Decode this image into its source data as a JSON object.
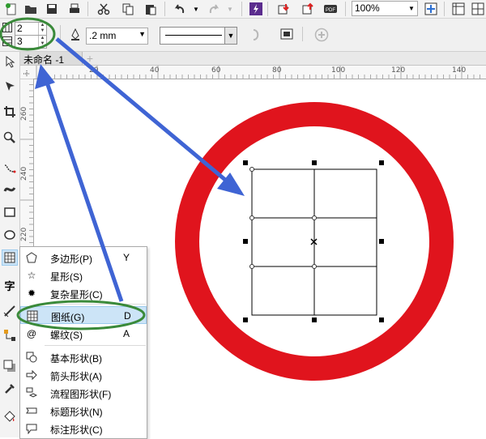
{
  "toolbar": {
    "zoom_value": "100%"
  },
  "property_bar": {
    "grid_columns": "2",
    "grid_rows": "3",
    "outline_width": ".2 mm"
  },
  "document": {
    "tab_name": "未命名 -1",
    "add_tab_symbol": "+"
  },
  "rulers": {
    "horizontal_labels": [
      "20",
      "40",
      "60",
      "80",
      "100",
      "120",
      "140"
    ],
    "vertical_labels": [
      "260",
      "240",
      "220"
    ]
  },
  "flyout": {
    "items": [
      {
        "label": "多边形(P)",
        "shortcut": "Y",
        "icon": "polygon-icon"
      },
      {
        "label": "星形(S)",
        "shortcut": "",
        "icon": "star-icon"
      },
      {
        "label": "复杂星形(C)",
        "shortcut": "",
        "icon": "complex-star-icon"
      },
      {
        "label": "图纸(G)",
        "shortcut": "D",
        "icon": "graph-paper-icon",
        "selected": true
      },
      {
        "label": "螺纹(S)",
        "shortcut": "A",
        "icon": "spiral-icon"
      },
      {
        "label": "基本形状(B)",
        "shortcut": "",
        "icon": "basic-shapes-icon"
      },
      {
        "label": "箭头形状(A)",
        "shortcut": "",
        "icon": "arrow-shapes-icon"
      },
      {
        "label": "流程图形状(F)",
        "shortcut": "",
        "icon": "flowchart-shapes-icon"
      },
      {
        "label": "标题形状(N)",
        "shortcut": "",
        "icon": "banner-shapes-icon"
      },
      {
        "label": "标注形状(C)",
        "shortcut": "",
        "icon": "callout-shapes-icon"
      }
    ]
  },
  "toolbox": {
    "text_tool_glyph": "字"
  },
  "colors": {
    "ring": "#e0141d",
    "annotation_arrow": "#3f64d4",
    "highlight_ellipse": "#3a8a3a",
    "menu_selection": "#cce4f7"
  }
}
